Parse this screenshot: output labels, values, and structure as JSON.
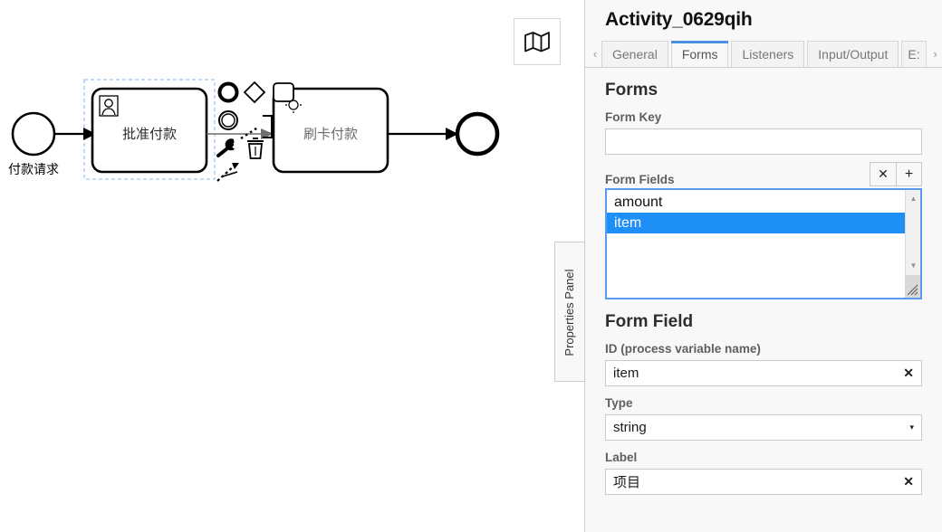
{
  "canvas": {
    "map_toggle_icon": "map-icon",
    "properties_panel_tab_label": "Properties Panel",
    "diagram": {
      "start_event": {
        "label": "付款请求",
        "type": "start-event"
      },
      "tasks": [
        {
          "id": "task-approve",
          "label": "批准付款",
          "type": "user-task",
          "selected": true
        },
        {
          "id": "task-card-payment",
          "label": "刷卡付款",
          "type": "service-task",
          "selected": false
        }
      ],
      "end_event": {
        "label": "",
        "type": "end-event"
      },
      "context_pad": [
        "append-end-event-icon",
        "append-gateway-icon",
        "append-task-icon",
        "append-intermediate-event-icon",
        "connect-icon",
        "wrench-icon",
        "trash-icon",
        "append-flow-icon"
      ]
    }
  },
  "panel": {
    "title": "Activity_0629qih",
    "tabs": {
      "scroll_left_icon": "chevron-left-icon",
      "scroll_right_icon": "chevron-right-icon",
      "items": [
        {
          "label": "General",
          "active": false
        },
        {
          "label": "Forms",
          "active": true
        },
        {
          "label": "Listeners",
          "active": false
        },
        {
          "label": "Input/Output",
          "active": false
        },
        {
          "label": "E:",
          "active": false
        }
      ]
    },
    "forms": {
      "section_title": "Forms",
      "form_key": {
        "label": "Form Key",
        "value": "",
        "placeholder": ""
      },
      "form_fields": {
        "label": "Form Fields",
        "remove_button": "✕",
        "add_button": "+",
        "items": [
          {
            "value": "amount",
            "selected": false
          },
          {
            "value": "item",
            "selected": true
          }
        ],
        "scroll_up_icon": "triangle-up-icon",
        "scroll_down_icon": "triangle-down-icon",
        "resize_grip_icon": "resize-grip-icon"
      }
    },
    "form_field": {
      "section_title": "Form Field",
      "id": {
        "label": "ID (process variable name)",
        "value": "item",
        "clear_icon": "✕"
      },
      "type": {
        "label": "Type",
        "value": "string",
        "caret_icon": "▾"
      },
      "field_label": {
        "label": "Label",
        "value": "项目",
        "clear_icon": "✕"
      }
    }
  },
  "colors": {
    "accent": "#4990e2",
    "selection_blue": "#1e90f5",
    "panel_bg": "#f8f8f8",
    "stroke": "#000000"
  }
}
